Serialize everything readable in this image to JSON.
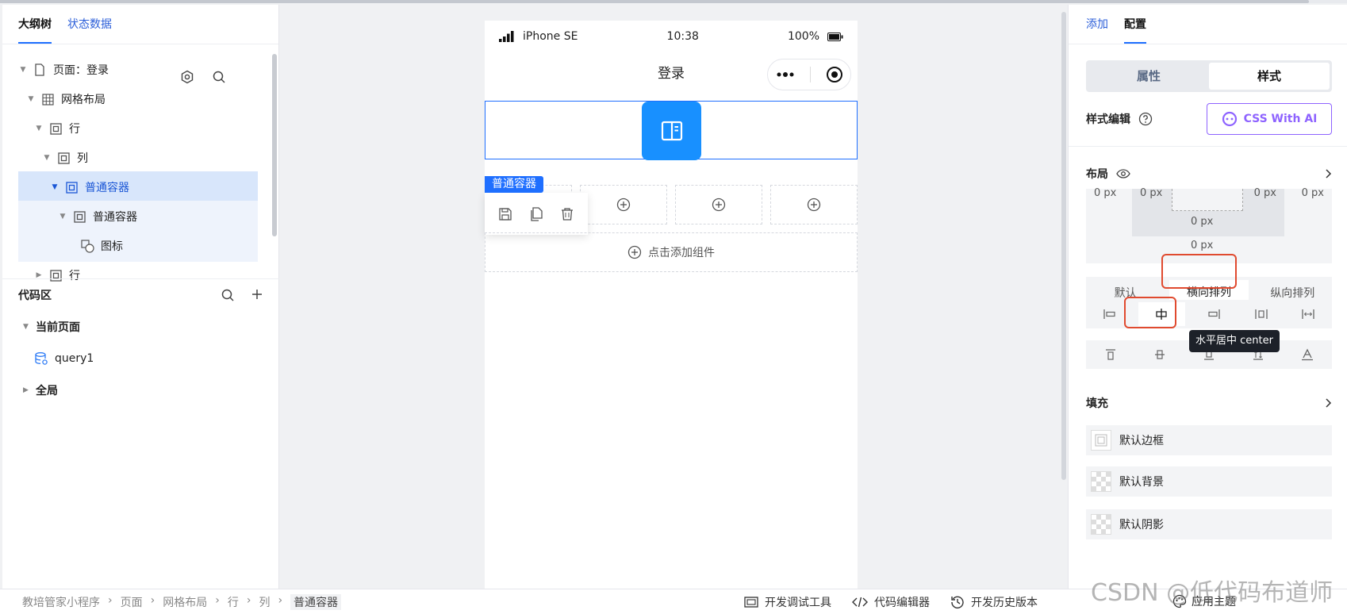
{
  "left": {
    "tabs": [
      {
        "label": "大纲树"
      },
      {
        "label": "状态数据"
      }
    ],
    "tree": [
      {
        "label": "页面：登录"
      },
      {
        "label": "网格布局"
      },
      {
        "label": "行"
      },
      {
        "label": "列"
      },
      {
        "label": "普通容器"
      },
      {
        "label": "普通容器"
      },
      {
        "label": "图标"
      },
      {
        "label": "行"
      }
    ],
    "code": {
      "title": "代码区",
      "current_page": "当前页面",
      "query": "query1",
      "global": "全局"
    }
  },
  "phone": {
    "carrier": "iPhone SE",
    "time": "10:38",
    "battery": "100%",
    "title": "登录",
    "selected_tag": "普通容器",
    "add_component": "点击添加组件"
  },
  "right": {
    "tabs": [
      {
        "label": "添加"
      },
      {
        "label": "配置"
      }
    ],
    "segment": [
      {
        "label": "属性"
      },
      {
        "label": "样式"
      }
    ],
    "style_edit": "样式编辑",
    "ai_button": "CSS With AI",
    "layout": "布局",
    "box": {
      "v1": "0 px",
      "v2": "0 px",
      "v3": "0 px",
      "v4": "0 px",
      "v5": "0 px",
      "v6": "0 px"
    },
    "direction": [
      {
        "label": "默认"
      },
      {
        "label": "横向排列"
      },
      {
        "label": "纵向排列"
      }
    ],
    "tooltip": "水平居中 center",
    "fill": "填充",
    "fill_items": [
      {
        "label": "默认边框"
      },
      {
        "label": "默认背景"
      },
      {
        "label": "默认阴影"
      }
    ]
  },
  "bottom": {
    "breadcrumbs": [
      "教培管家小程序",
      "页面",
      "网格布局",
      "行",
      "列",
      "普通容器"
    ],
    "tools": [
      {
        "label": "开发调试工具"
      },
      {
        "label": "代码编辑器"
      },
      {
        "label": "开发历史版本"
      }
    ],
    "theme": "应用主题",
    "watermark": "CSDN @低代码布道师"
  },
  "colors": {
    "accent": "#1f6fff",
    "highlight": "#e04a2f",
    "ai": "#8e63ff",
    "icon_bg": "#1890ff"
  }
}
